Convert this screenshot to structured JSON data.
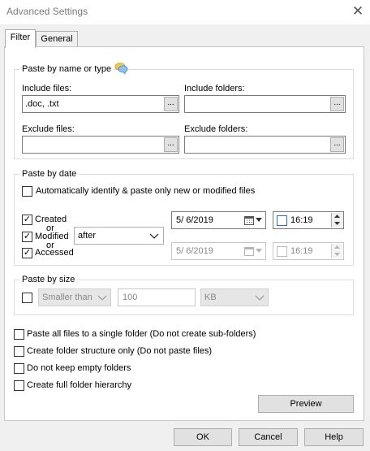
{
  "window": {
    "title": "Advanced Settings",
    "close_glyph": "✕"
  },
  "tabs": [
    "Filter",
    "General"
  ],
  "name_group": {
    "title": "Paste by name or type",
    "include_files_label": "Include files:",
    "include_files_value": ".doc, .txt",
    "include_folders_label": "Include folders:",
    "include_folders_value": "",
    "exclude_files_label": "Exclude files:",
    "exclude_files_value": "",
    "exclude_folders_label": "Exclude folders:",
    "exclude_folders_value": "",
    "browse_label": "..."
  },
  "date_group": {
    "title": "Paste by date",
    "auto_label": "Automatically identify & paste only new or modified files",
    "created_label": "Created",
    "or1": "or",
    "modified_label": "Modified",
    "or2": "or",
    "accessed_label": "Accessed",
    "condition_value": "after",
    "date1": "5/ 6/2019",
    "time1": "16:19",
    "date2": "5/ 6/2019",
    "time2": "16:19"
  },
  "size_group": {
    "title": "Paste by size",
    "comparison_value": "Smaller than",
    "size_value": "100",
    "unit_value": "KB"
  },
  "options": [
    "Paste all files to a single folder (Do not create sub-folders)",
    "Create folder structure only (Do not paste files)",
    "Do not keep empty folders",
    "Create full folder hierarchy"
  ],
  "buttons": {
    "preview": "Preview",
    "ok": "OK",
    "cancel": "Cancel",
    "help": "Help"
  },
  "check_glyph": "✓",
  "colors": {
    "accent": "#2a6bd6"
  }
}
